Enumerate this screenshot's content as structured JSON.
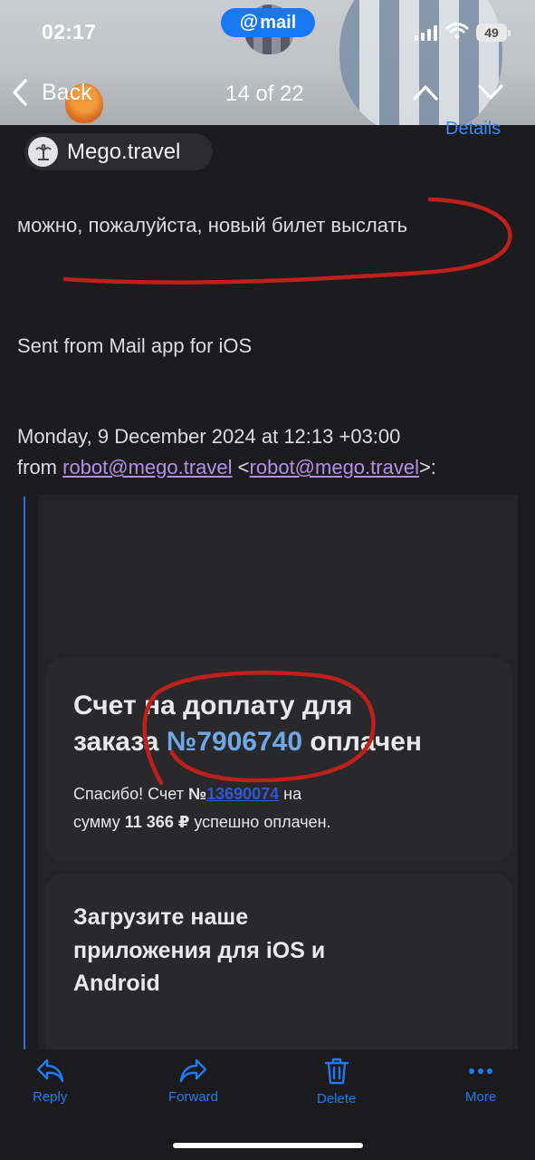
{
  "status_bar": {
    "time": "02:17",
    "battery": "49"
  },
  "app_pill": {
    "at": "@",
    "name": "mail"
  },
  "nav": {
    "back_label": "Back",
    "counter": "14 of 22"
  },
  "message": {
    "details_label": "Details",
    "sender_name": "Mego.travel",
    "reply_text": "можно, пожалуйста, новый билет выслать",
    "signature": "Sent from Mail app for iOS",
    "quote_header_date": "Monday, 9 December 2024 at 12:13 +03:00",
    "quote_from_prefix": "from",
    "quote_from_email": "robot@mego.travel",
    "quote_from_open": "<",
    "quote_from_email_2": "robot@mego.travel",
    "quote_from_close": ">:"
  },
  "invoice_card": {
    "title_line1": "Счет на доплату для",
    "title_line2_prefix": "заказа",
    "order_number": "№7906740",
    "title_line2_suffix": "оплачен",
    "body_line1_prefix": "Спасибо! Счет",
    "invoice_no_sign": "№",
    "invoice_number": "13690074",
    "body_line1_suffix": "на",
    "body_line2_prefix": "сумму",
    "amount": "11 366 ₽",
    "body_line2_suffix": "успешно оплачен."
  },
  "app_card": {
    "line1": "Загрузите наше",
    "line2": "приложения для iOS и",
    "line3": "Android"
  },
  "toolbar": {
    "reply": "Reply",
    "forward": "Forward",
    "delete": "Delete",
    "more": "More"
  },
  "colors": {
    "accent": "#1e7cf2",
    "link_purple": "#b38fe6",
    "order_blue": "#6fa8e6",
    "annotation_red": "#c0201c",
    "background": "#1c1c1e"
  }
}
